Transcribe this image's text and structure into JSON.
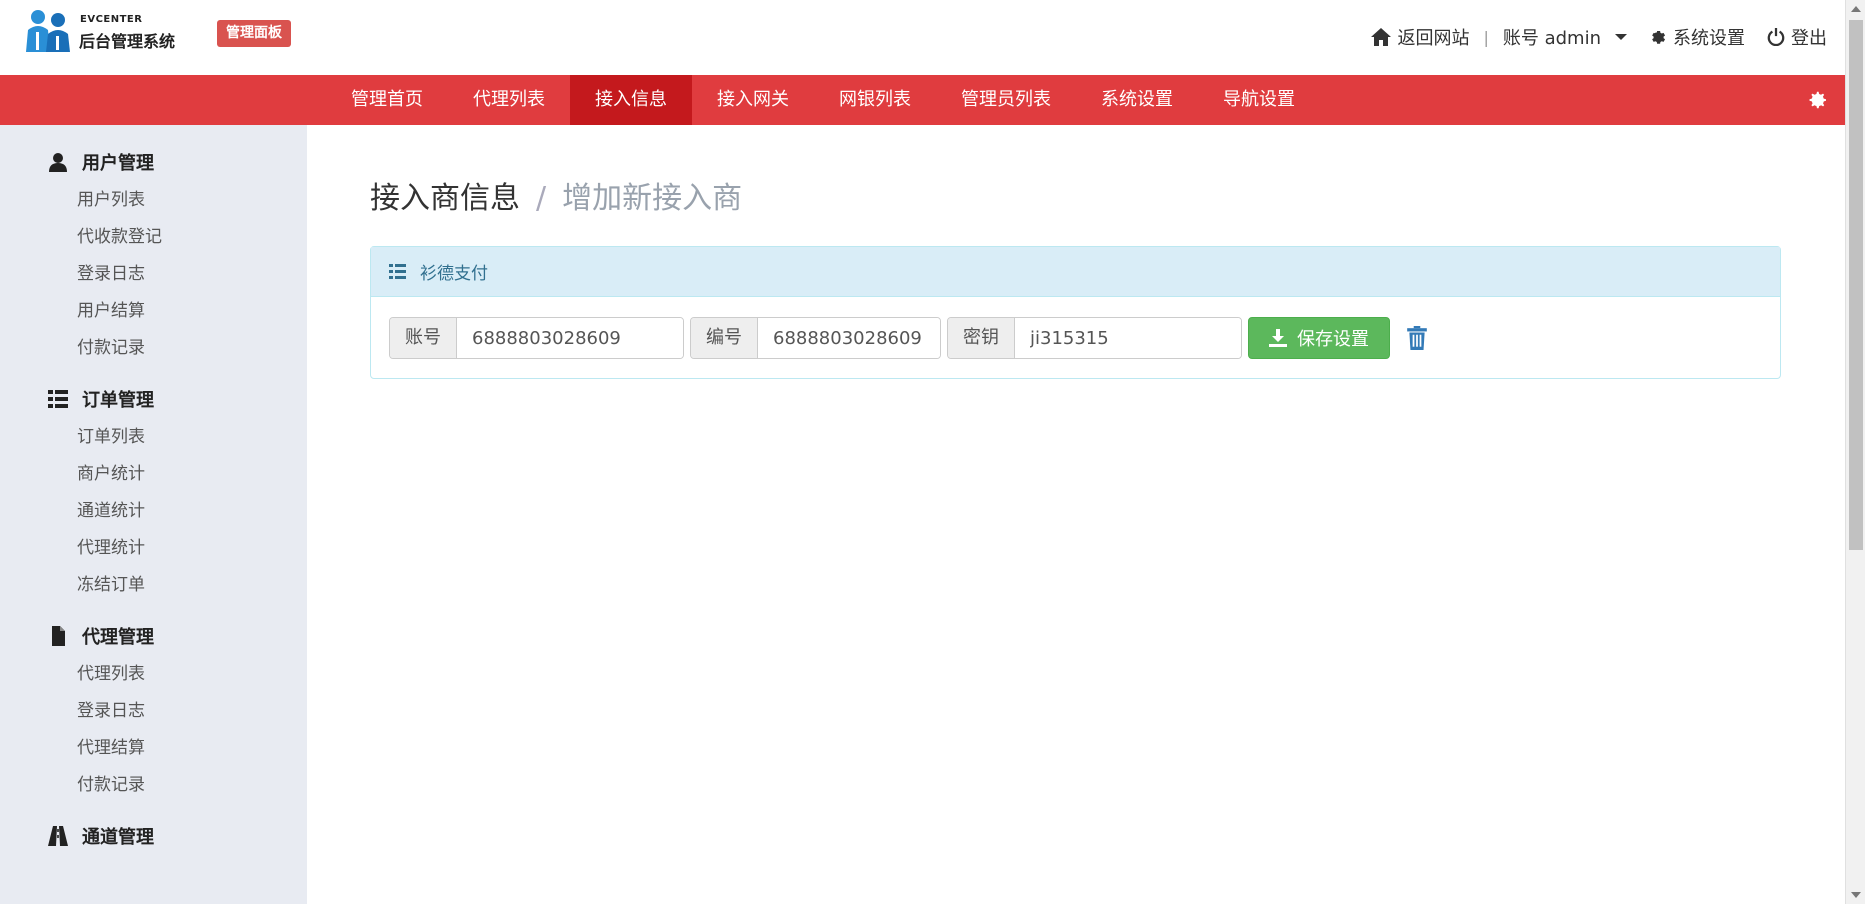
{
  "header": {
    "brand_small": "EVCENTER",
    "brand_main": "后台管理系统",
    "panel_badge": "管理面板",
    "back_to_site": "返回网站",
    "account": "账号 admin",
    "settings": "系统设置",
    "logout": "登出"
  },
  "nav": {
    "items": [
      {
        "label": "管理首页"
      },
      {
        "label": "代理列表"
      },
      {
        "label": "接入信息",
        "active": true
      },
      {
        "label": "接入网关"
      },
      {
        "label": "网银列表"
      },
      {
        "label": "管理员列表"
      },
      {
        "label": "系统设置"
      },
      {
        "label": "导航设置"
      }
    ]
  },
  "sidebar": {
    "groups": [
      {
        "title": "用户管理",
        "icon": "user-icon",
        "items": [
          "用户列表",
          "代收款登记",
          "登录日志",
          "用户结算",
          "付款记录"
        ]
      },
      {
        "title": "订单管理",
        "icon": "list-icon",
        "items": [
          "订单列表",
          "商户统计",
          "通道统计",
          "代理统计",
          "冻结订单"
        ]
      },
      {
        "title": "代理管理",
        "icon": "file-icon",
        "items": [
          "代理列表",
          "登录日志",
          "代理结算",
          "付款记录"
        ]
      },
      {
        "title": "通道管理",
        "icon": "road-icon",
        "items": []
      }
    ]
  },
  "main": {
    "title": "接入商信息",
    "separator": "/",
    "subtitle": "增加新接入商",
    "panel": {
      "heading": "衫德支付",
      "fields": [
        {
          "label": "账号",
          "value": "6888803028609"
        },
        {
          "label": "编号",
          "value": "6888803028609"
        },
        {
          "label": "密钥",
          "value": "ji315315"
        }
      ],
      "save_label": "保存设置"
    }
  },
  "colors": {
    "nav_bg": "#e03c3f",
    "nav_active": "#c4191d",
    "sidebar_bg": "#e8ebf2",
    "panel_head": "#d9edf7",
    "save_green": "#5cb85c",
    "badge_red": "#d9534f"
  }
}
